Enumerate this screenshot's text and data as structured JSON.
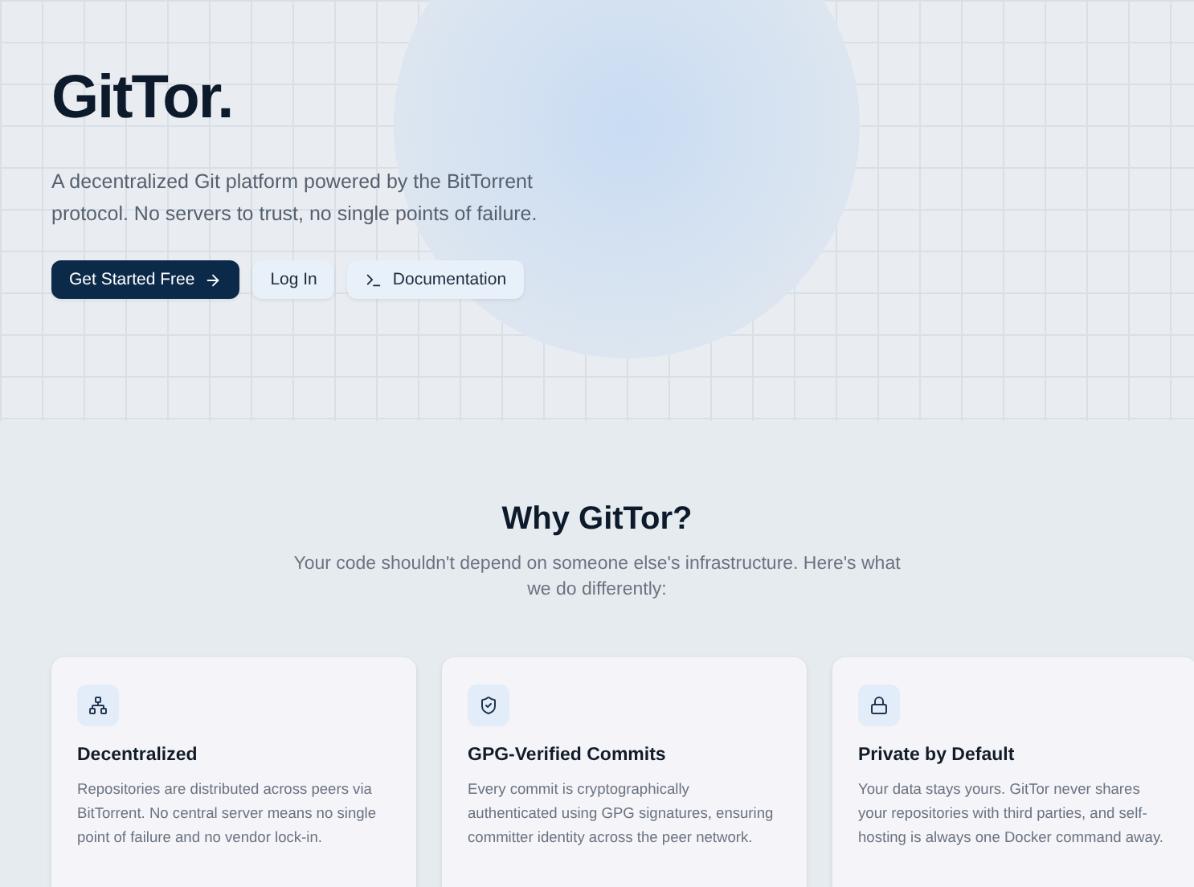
{
  "hero": {
    "title": "GitTor.",
    "tagline": "A decentralized Git platform powered by the BitTorrent protocol. No servers to trust, no single points of failure.",
    "buttons": [
      {
        "kind": "primary",
        "label": "Get Started Free"
      },
      {
        "kind": "secondary",
        "label": "Log In"
      },
      {
        "kind": "secondary",
        "label": "Documentation"
      }
    ]
  },
  "features": {
    "title": "Why GitTor?",
    "subtitle": "Your code shouldn't depend on someone else's infrastructure. Here's what we do differently:",
    "cards": [
      {
        "title": "Decentralized",
        "text": "Repositories are distributed across peers via BitTorrent. No central server means no single point of failure and no vendor lock-in."
      },
      {
        "title": "GPG-Verified Commits",
        "text": "Every commit is cryptographically authenticated using GPG signatures, ensuring committer identity across the peer network."
      },
      {
        "title": "Private by Default",
        "text": "Your data stays yours. GitTor never shares your repositories with third parties, and self-hosting is always one Docker command away."
      }
    ]
  }
}
